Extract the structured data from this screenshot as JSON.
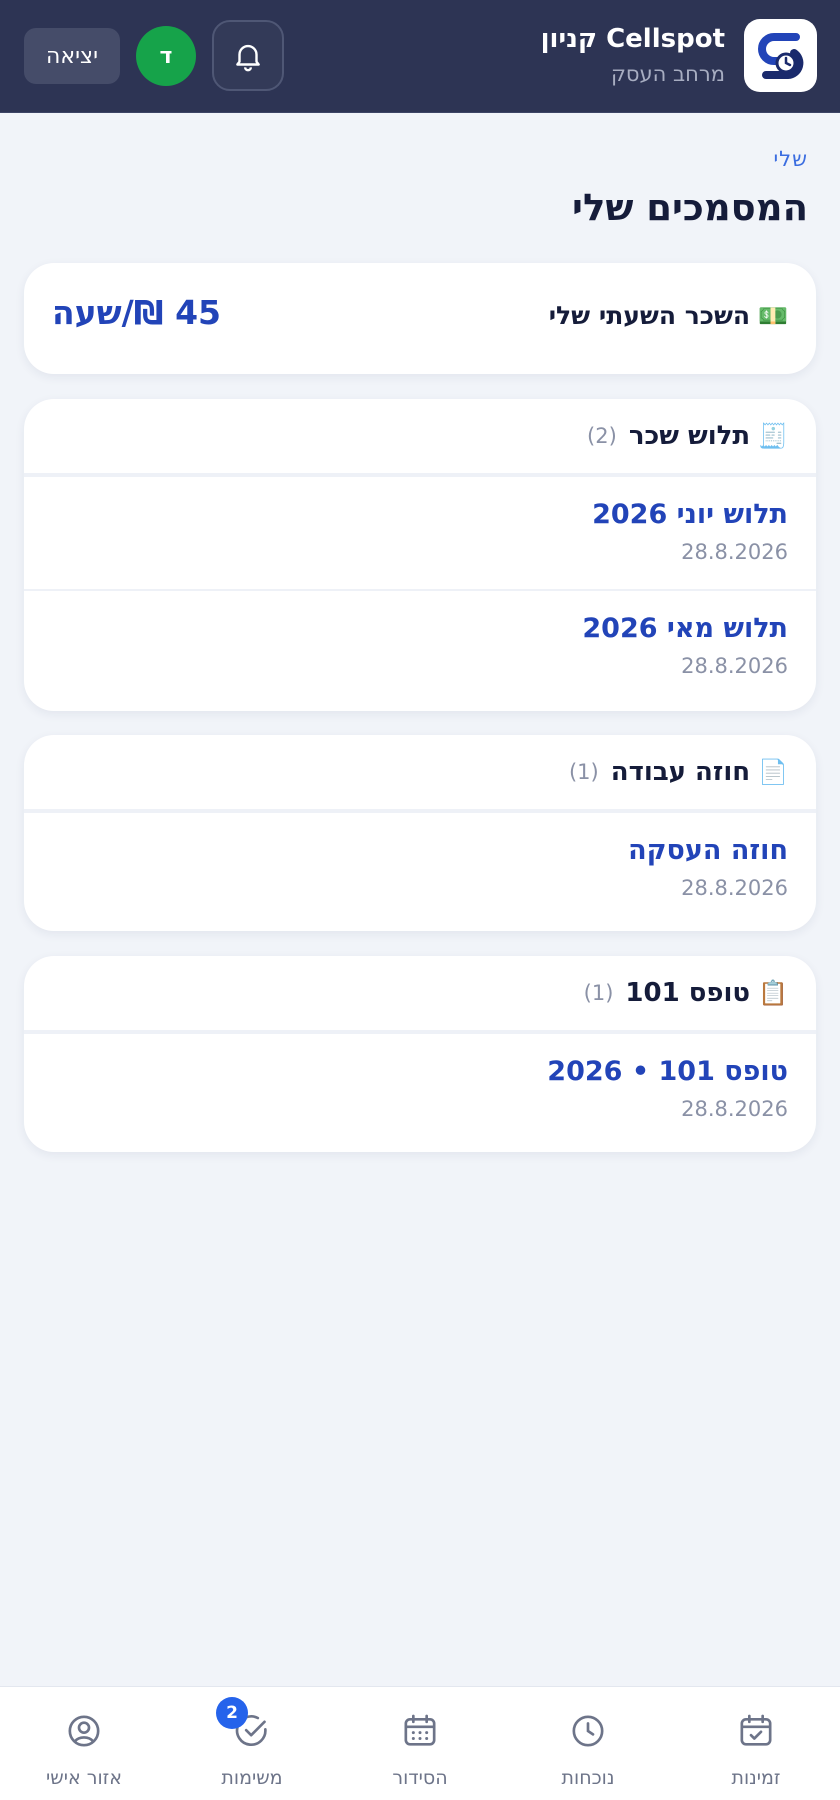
{
  "header": {
    "brand_title": "Cellspot קניון",
    "brand_subtitle": "מרחב העסק",
    "avatar_initial": "ד",
    "logout_label": "יציאה",
    "accent_color": "#2d3454"
  },
  "page": {
    "kicker": "שלי",
    "title": "המסמכים שלי"
  },
  "wage": {
    "emoji": "💵",
    "label": "השכר השעתי שלי",
    "value": "45 ₪/שעה"
  },
  "sections": [
    {
      "emoji": "🧾",
      "title": "תלוש שכר",
      "count": "(2)",
      "items": [
        {
          "title": "תלוש יוני 2026",
          "date": "28.8.2026"
        },
        {
          "title": "תלוש מאי 2026",
          "date": "28.8.2026"
        }
      ]
    },
    {
      "emoji": "📄",
      "title": "חוזה עבודה",
      "count": "(1)",
      "items": [
        {
          "title": "חוזה העסקה",
          "date": "28.8.2026"
        }
      ]
    },
    {
      "emoji": "📋",
      "title": "טופס 101",
      "count": "(1)",
      "items": [
        {
          "title": "טופס 101 • 2026",
          "date": "28.8.2026"
        }
      ]
    }
  ],
  "nav": {
    "items": [
      {
        "label": "זמינות",
        "icon": "calendar-check-icon"
      },
      {
        "label": "נוכחות",
        "icon": "clock-icon"
      },
      {
        "label": "הסידור",
        "icon": "calendar-grid-icon"
      },
      {
        "label": "משימות",
        "icon": "check-circle-icon",
        "badge": "2"
      },
      {
        "label": "אזור אישי",
        "icon": "user-circle-icon"
      }
    ]
  }
}
